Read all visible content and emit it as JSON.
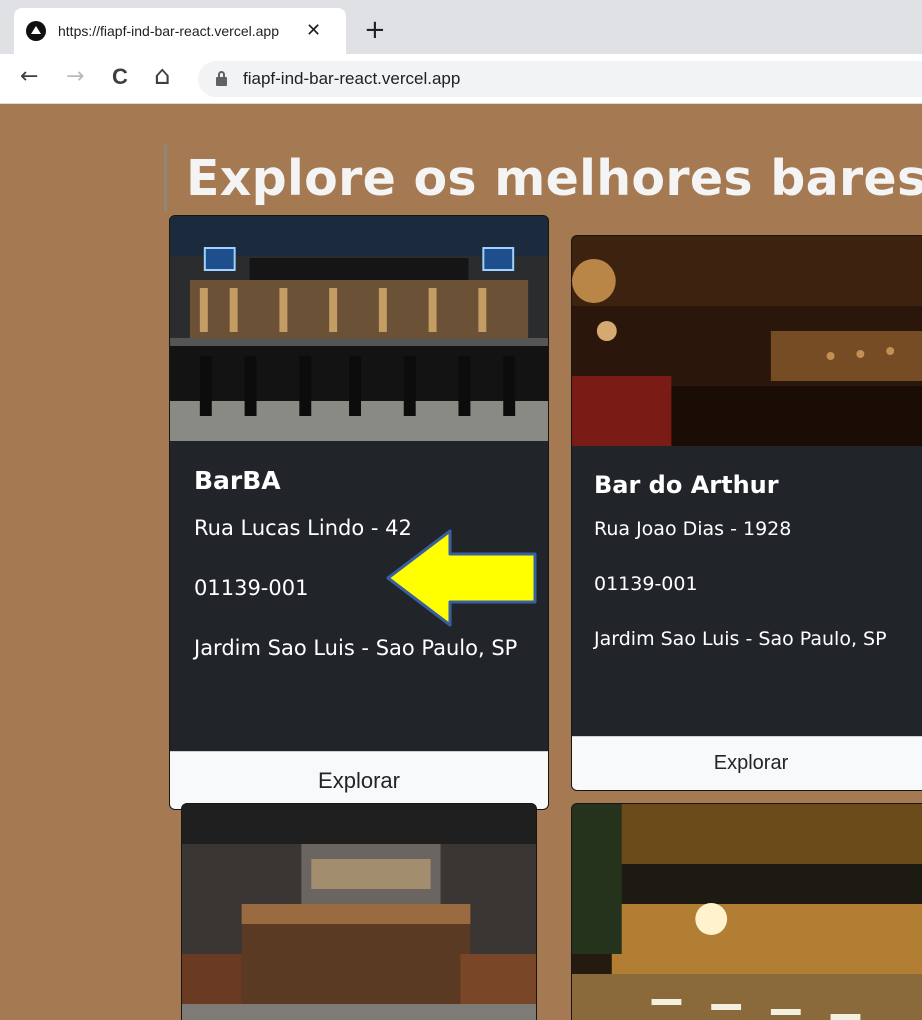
{
  "browser": {
    "tab_title": "https://fiapf-ind-bar-react.vercel.app",
    "tab_close": "✕",
    "new_tab": "+",
    "back": "←",
    "forward": "→",
    "reload": "C",
    "home": "⌂",
    "url": "fiapf-ind-bar-react.vercel.app"
  },
  "page": {
    "heading": "Explore os melhores bares:",
    "button_label": "Explorar",
    "bars": [
      {
        "name": "BarBA",
        "street": "Rua Lucas Lindo - 42",
        "zip": "01139-001",
        "district": "Jardim Sao Luis - Sao Paulo, SP"
      },
      {
        "name": "Bar do Arthur",
        "street": "Rua Joao Dias - 1928",
        "zip": "01139-001",
        "district": "Jardim Sao Luis - Sao Paulo, SP"
      }
    ]
  },
  "colors": {
    "page_background": "#a57a52",
    "card_background": "#212529",
    "button_background": "#f8f9fa",
    "arrow_fill": "#ffff00",
    "arrow_outline": "#3a5fa0"
  },
  "icons": {
    "favicon": "triangle-logo-icon",
    "lock": "lock-icon",
    "pointer": "arrow-left-icon"
  }
}
